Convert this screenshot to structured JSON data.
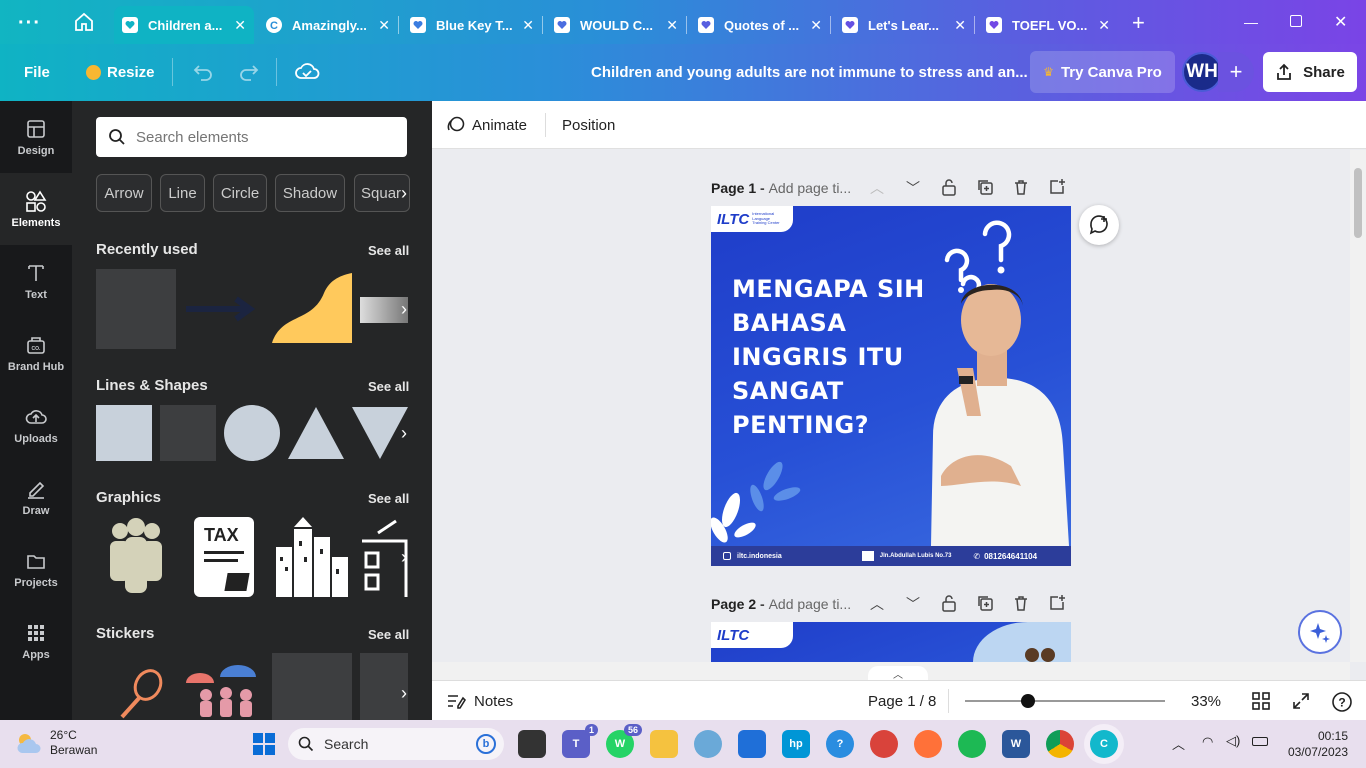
{
  "tabs": [
    {
      "label": "Children a...",
      "active": true
    },
    {
      "label": "Amazingly..."
    },
    {
      "label": "Blue Key T..."
    },
    {
      "label": "WOULD C..."
    },
    {
      "label": "Quotes of ..."
    },
    {
      "label": "Let's Lear..."
    },
    {
      "label": "TOEFL VO..."
    }
  ],
  "header": {
    "file": "File",
    "resize": "Resize",
    "doc_title": "Children and young adults are not immune to stress and an...",
    "try_pro": "Try Canva Pro",
    "avatar": "WH",
    "share": "Share"
  },
  "rail": [
    {
      "label": "Design"
    },
    {
      "label": "Elements"
    },
    {
      "label": "Text"
    },
    {
      "label": "Brand Hub"
    },
    {
      "label": "Uploads"
    },
    {
      "label": "Draw"
    },
    {
      "label": "Projects"
    },
    {
      "label": "Apps"
    }
  ],
  "panel": {
    "search_placeholder": "Search elements",
    "chips": [
      "Arrow",
      "Line",
      "Circle",
      "Shadow",
      "Squar"
    ],
    "recent": "Recently used",
    "lines_shapes": "Lines & Shapes",
    "graphics": "Graphics",
    "stickers": "Stickers",
    "see_all": "See all",
    "tax_text": "TAX"
  },
  "toolbar": {
    "animate": "Animate",
    "position": "Position"
  },
  "pages": [
    {
      "label": "Page 1",
      "placeholder": "Add page ti..."
    },
    {
      "label": "Page 2",
      "placeholder": "Add page ti..."
    }
  ],
  "design": {
    "logo": "ILTC",
    "logo_sub": "International Language Training Center",
    "headline": [
      "MENGAPA SIH",
      "BAHASA",
      "INGGRIS ITU",
      "SANGAT",
      "PENTING?"
    ],
    "footer_ig": "iltc.indonesia",
    "footer_addr": "Jln.Abdullah Lubis No.73",
    "footer_phone": "081264641104"
  },
  "bottom": {
    "notes": "Notes",
    "page_count": "Page 1 / 8",
    "zoom": "33%"
  },
  "taskbar": {
    "temp": "26°C",
    "weather": "Berawan",
    "search": "Search",
    "time": "00:15",
    "date": "03/07/2023",
    "teams_badge": "1",
    "whatsapp_badge": "56"
  },
  "colors": {
    "accent": "#7b45e6",
    "teal": "#0fb3c4",
    "design_blue": "#1a3fc4"
  }
}
